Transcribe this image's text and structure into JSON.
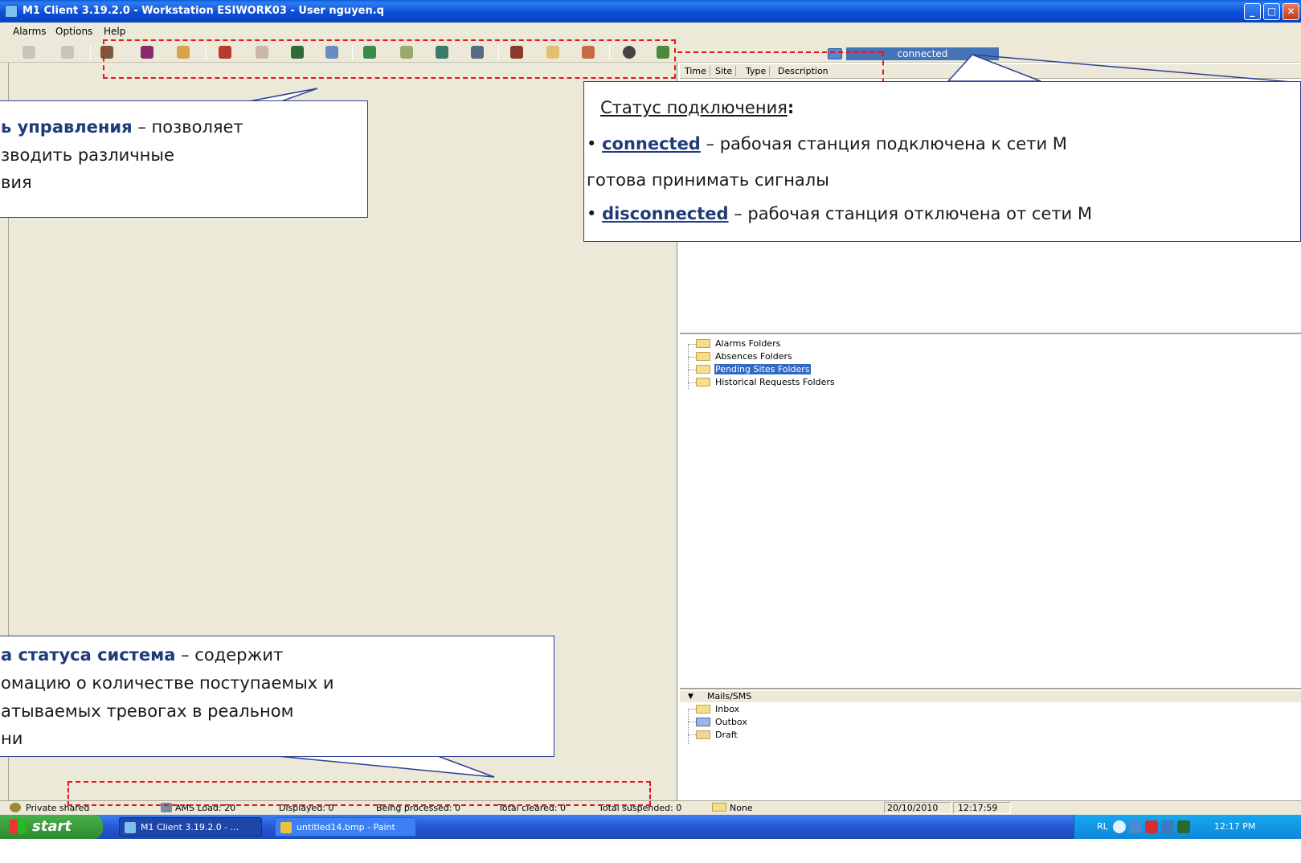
{
  "window": {
    "title": "M1 Client 3.19.2.0 - Workstation ESIWORK03 - User nguyen.q",
    "buttons": [
      "_",
      "□",
      "✕"
    ]
  },
  "menu": [
    "Alarms",
    "Options",
    "Help"
  ],
  "toolbar": {
    "connection_status": "connected"
  },
  "alarm_columns": [
    "Time",
    "Site",
    "Type",
    "Description"
  ],
  "folders": [
    {
      "label": "Alarms Folders",
      "selected": false
    },
    {
      "label": "Absences Folders",
      "selected": false
    },
    {
      "label": "Pending Sites Folders",
      "selected": true
    },
    {
      "label": "Historical Requests Folders",
      "selected": false
    }
  ],
  "mail": {
    "header": "Mails/SMS",
    "items": [
      "Inbox",
      "Outbox",
      "Draft"
    ]
  },
  "statusbar": {
    "mode": "Private shared",
    "ams_load": "AMS Load: 20",
    "displayed": "Displayed: 0",
    "being_processed": "Being processed: 0",
    "total_cleared": "Total cleared: 0",
    "total_suspended": "Total suspended: 0",
    "filter": "None",
    "date": "20/10/2010",
    "time": "12:17:59"
  },
  "taskbar": {
    "start": "start",
    "tasks": [
      "M1 Client 3.19.2.0 - ...",
      "untitled14.bmp - Paint"
    ],
    "tray_lang": "RL",
    "clock": "12:17 PM"
  },
  "annotations": {
    "toolbar_callout": {
      "line1_bold": "ь управления",
      "line1_rest": " – позволяет",
      "line2": "зводить различные",
      "line3": "вия"
    },
    "status_callout": {
      "title": "Статус подключения",
      "title_colon": ":",
      "connected_word": "connected",
      "connected_text": " – рабочая станция подключена к сети М",
      "connected_line2": "готова принимать сигналы",
      "disconnected_word": "disconnected",
      "disconnected_text": " – рабочая станция отключена от сети М"
    },
    "statusbar_callout": {
      "line1_bold": "а статуса система",
      "line1_rest": " – содержит",
      "line2": "омацию о количестве поступаемых и",
      "line3": "атываемых тревогах в реальном",
      "line4": "ни"
    }
  },
  "colors": {
    "annotation_dash": "#e8141c",
    "callout_border": "#2e3f95",
    "xp_face": "#ece9d8",
    "title_blue": "#0b4fd8"
  }
}
